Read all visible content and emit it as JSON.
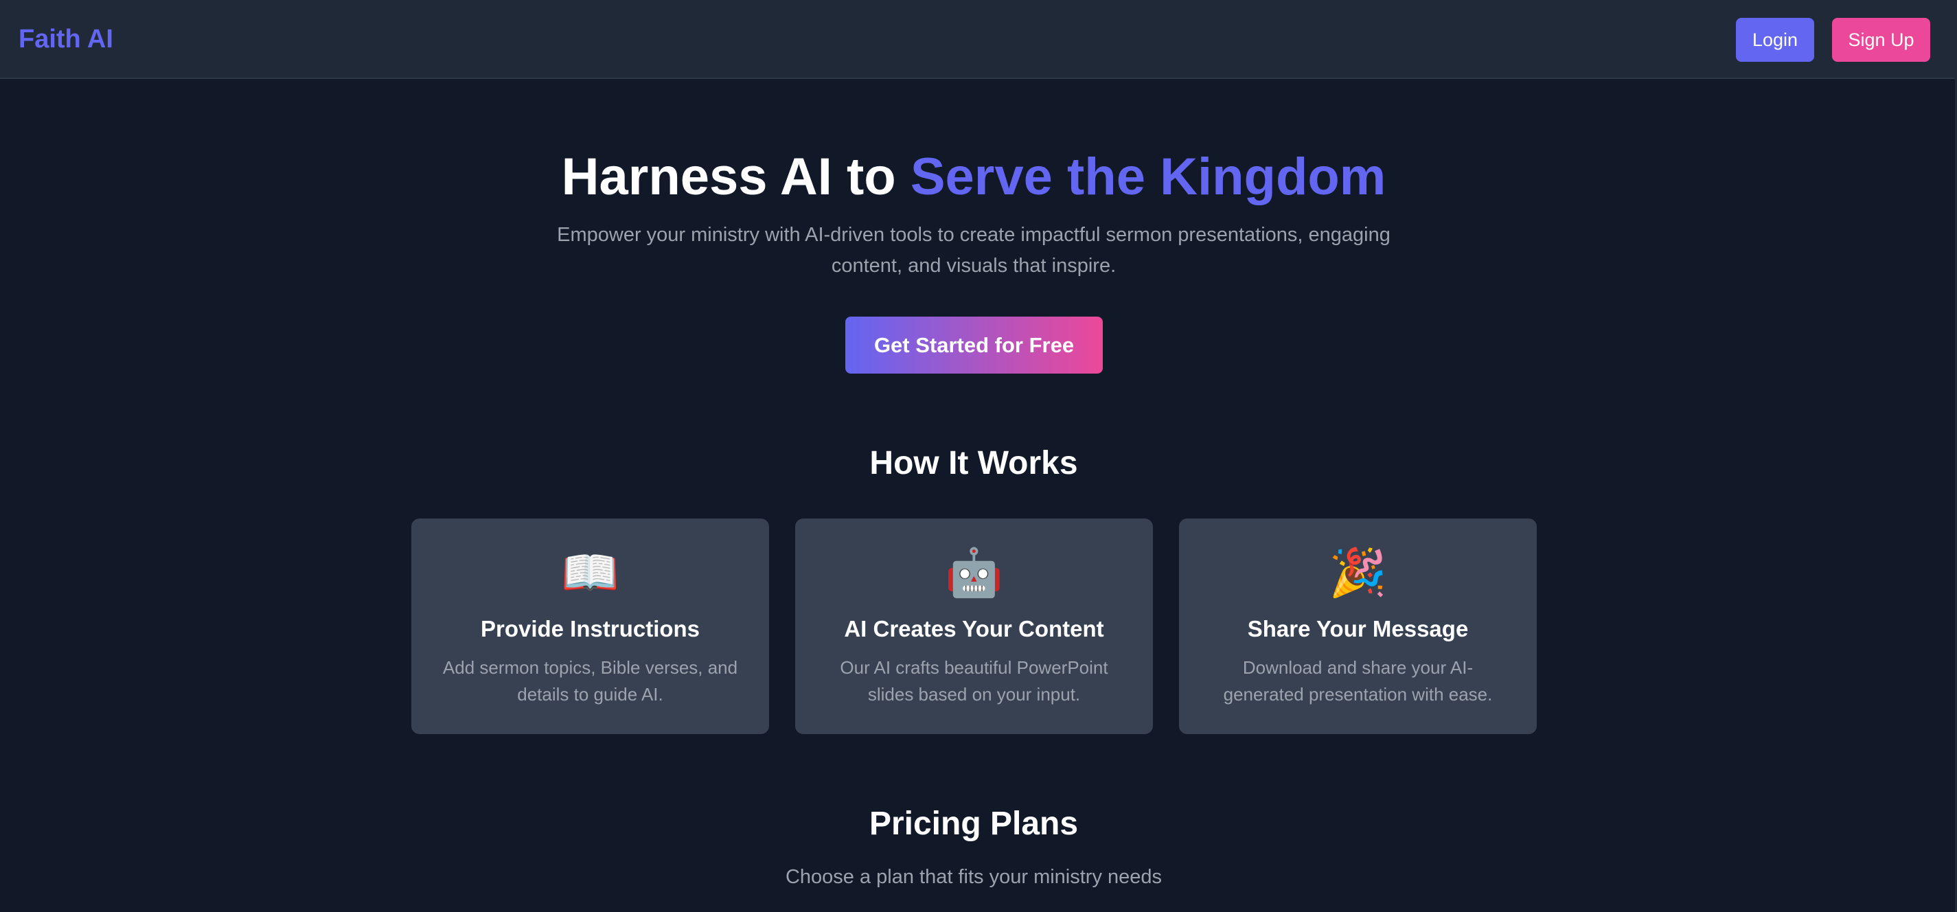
{
  "header": {
    "brand": "Faith AI",
    "login_label": "Login",
    "signup_label": "Sign Up"
  },
  "hero": {
    "title_plain": "Harness AI to ",
    "title_accent": "Serve the Kingdom",
    "subtitle": "Empower your ministry with AI-driven tools to create impactful sermon presentations, engaging content, and visuals that inspire.",
    "cta_label": "Get Started for Free"
  },
  "how_it_works": {
    "title": "How It Works",
    "cards": [
      {
        "icon": "open-book-icon",
        "glyph": "📖",
        "title": "Provide Instructions",
        "description": "Add sermon topics, Bible verses, and details to guide AI."
      },
      {
        "icon": "robot-icon",
        "glyph": "🤖",
        "title": "AI Creates Your Content",
        "description": "Our AI crafts beautiful PowerPoint slides based on your input."
      },
      {
        "icon": "party-popper-icon",
        "glyph": "🎉",
        "title": "Share Your Message",
        "description": "Download and share your AI-generated presentation with ease."
      }
    ]
  },
  "pricing": {
    "title": "Pricing Plans",
    "subtitle": "Choose a plan that fits your ministry needs"
  },
  "colors": {
    "background": "#111827",
    "navbar": "#1f2937",
    "card": "#374151",
    "accent_indigo": "#6366f1",
    "accent_pink": "#ec4899",
    "muted_text": "#9ca3af"
  }
}
